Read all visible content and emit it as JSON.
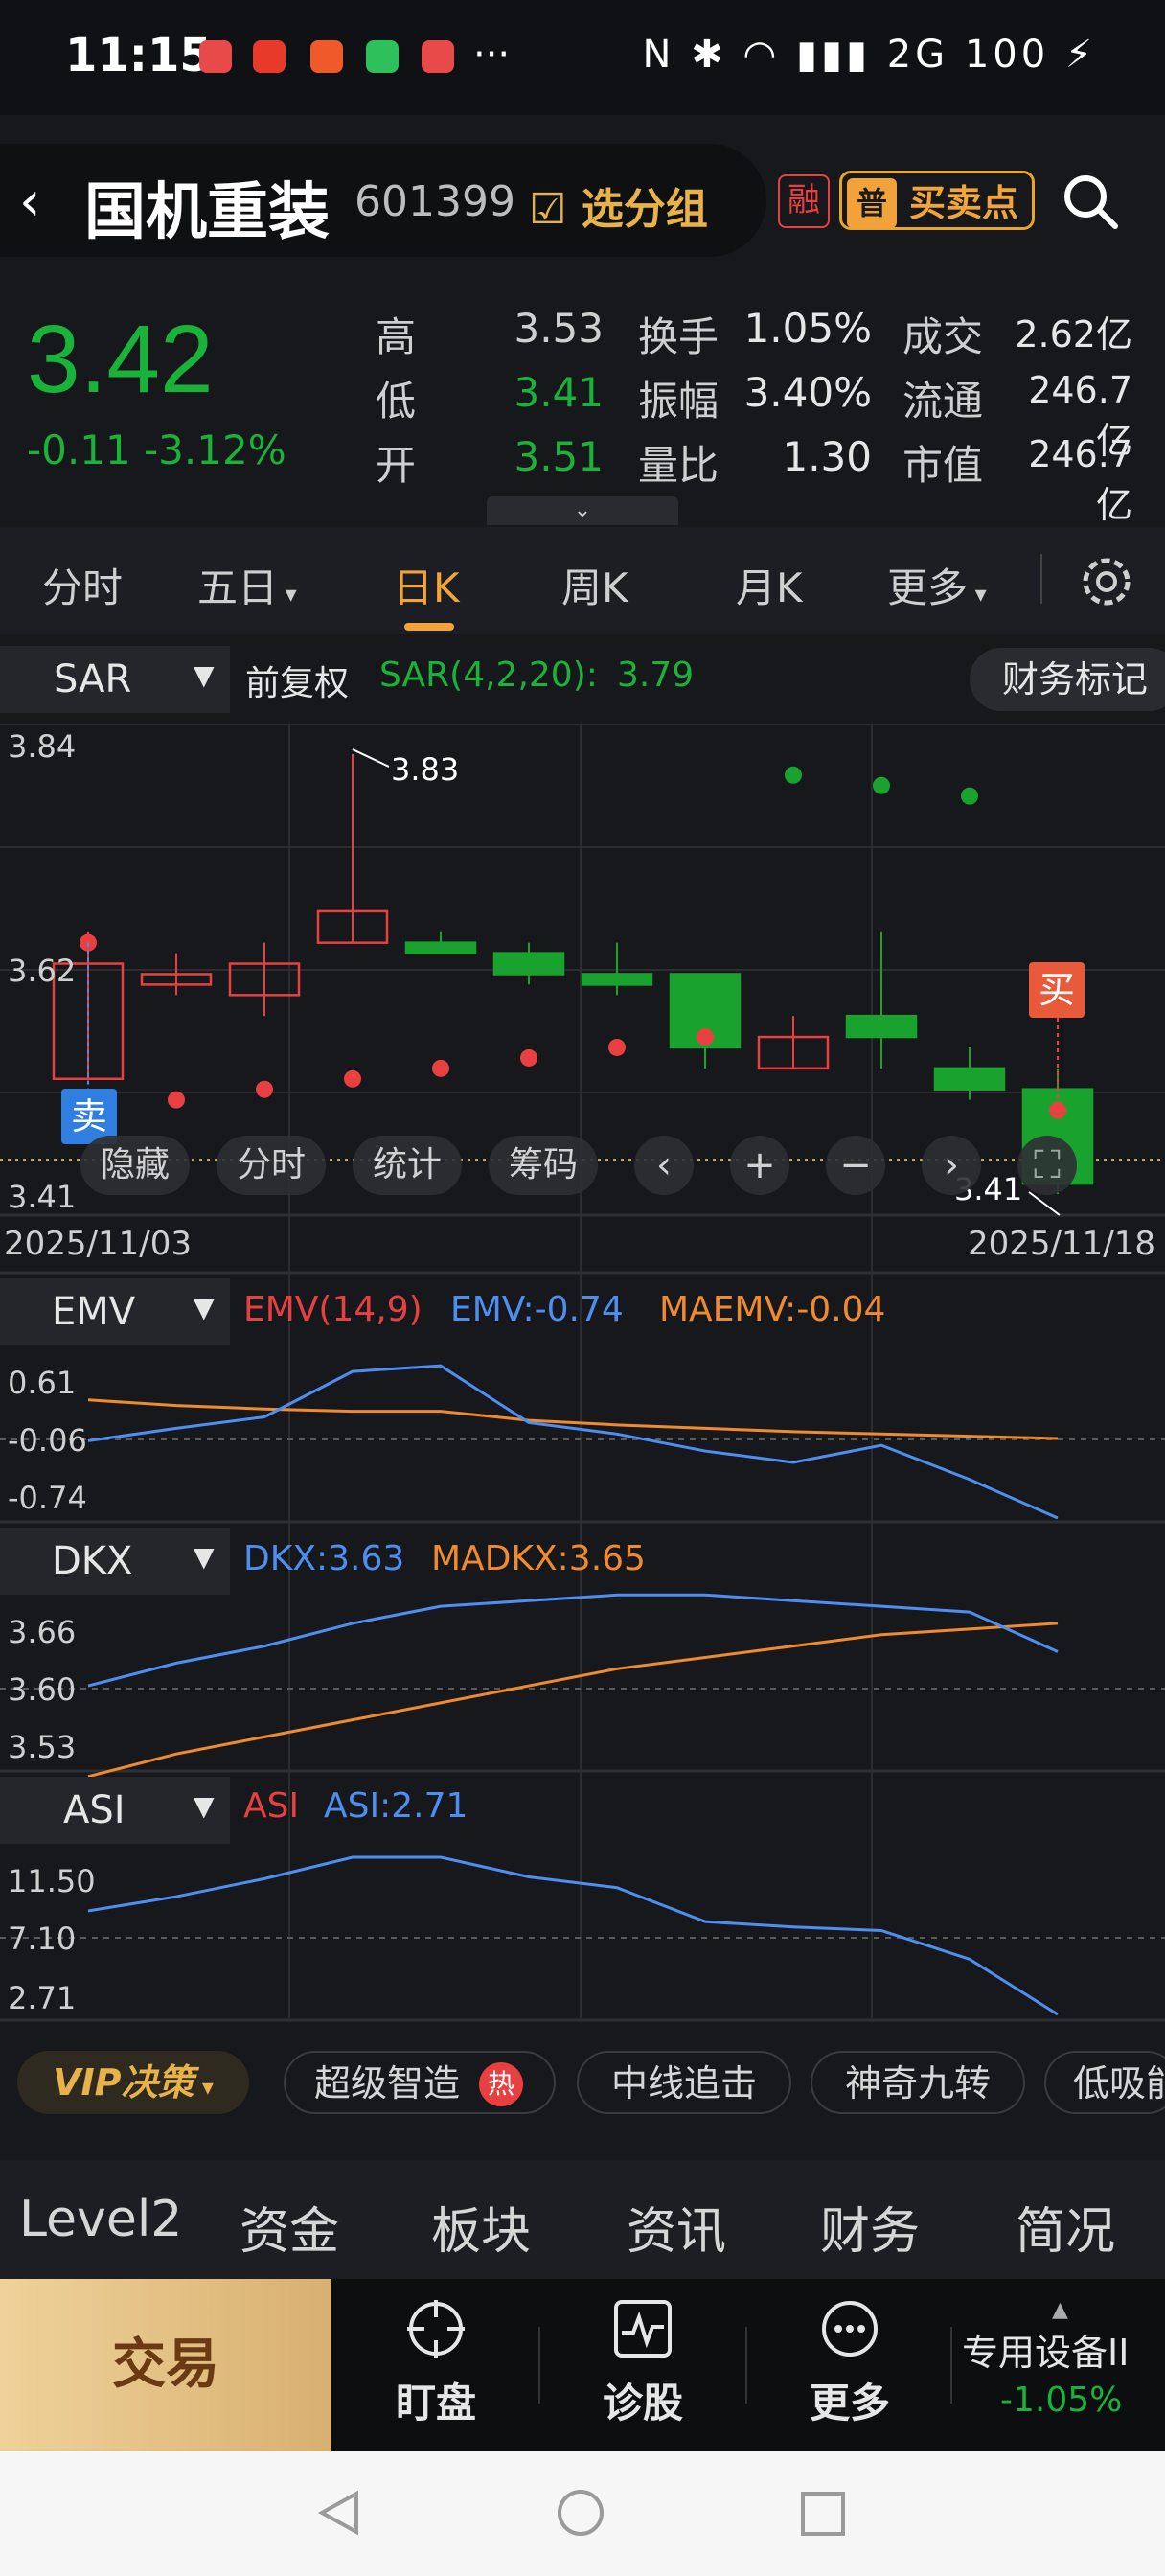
{
  "status_bar": {
    "time": "11:15",
    "right": "N ✱ ◠ ▮▮▮ 2G 100 ⚡",
    "more": "···"
  },
  "header": {
    "stock_name": "国机重装",
    "stock_code": "601399",
    "group_label": "选分组",
    "rong_badge": "融",
    "buysell_label": "买卖点",
    "buysell_icon": "普"
  },
  "quote": {
    "price": "3.42",
    "change": "-0.11 -3.12%",
    "rows": [
      {
        "l1": "高",
        "v1": "3.53",
        "c1": "#cfcfcf",
        "l2": "换手",
        "v2": "1.05%",
        "l3": "成交",
        "v3": "2.62亿"
      },
      {
        "l1": "低",
        "v1": "3.41",
        "c1": "#19b33a",
        "l2": "振幅",
        "v2": "3.40%",
        "l3": "流通",
        "v3": "246.7亿"
      },
      {
        "l1": "开",
        "v1": "3.51",
        "c1": "#19b33a",
        "l2": "量比",
        "v2": "1.30",
        "l3": "市值",
        "v3": "246.7亿"
      }
    ]
  },
  "period_tabs": [
    "分时",
    "五日",
    "日K",
    "周K",
    "月K",
    "更多"
  ],
  "sar_panel": {
    "selector": "SAR",
    "adjust": "前复权",
    "indicator": "SAR(4,2,20):",
    "value": "3.79",
    "finance_btn": "财务标记",
    "y_labels": [
      "3.84",
      "3.62",
      "3.41"
    ],
    "high_label": "3.83",
    "low_label": "3.41",
    "date_start": "2025/11/03",
    "date_end": "2025/11/18",
    "sell_marker": "卖",
    "buy_marker": "买",
    "tools": [
      "隐藏",
      "分时",
      "统计",
      "筹码"
    ]
  },
  "emv_panel": {
    "selector": "EMV",
    "name": "EMV(14,9)",
    "emv": "EMV:-0.74",
    "maemv": "MAEMV:-0.04",
    "y_labels": [
      "0.61",
      "-0.06",
      "-0.74"
    ]
  },
  "dkx_panel": {
    "selector": "DKX",
    "dkx": "DKX:3.63",
    "madkx": "MADKX:3.65",
    "y_labels": [
      "3.66",
      "3.60",
      "3.53"
    ]
  },
  "asi_panel": {
    "selector": "ASI",
    "name": "ASI",
    "asi": "ASI:2.71",
    "y_labels": [
      "11.50",
      "7.10",
      "2.71"
    ]
  },
  "chart_data": {
    "type": "candlestick",
    "dates": [
      "2025/11/03",
      "2025/11/18"
    ],
    "candles": [
      {
        "open": 3.52,
        "close": 3.63,
        "high": 3.66,
        "low": 3.52
      },
      {
        "open": 3.61,
        "close": 3.62,
        "high": 3.64,
        "low": 3.6
      },
      {
        "open": 3.6,
        "close": 3.63,
        "high": 3.65,
        "low": 3.58
      },
      {
        "open": 3.65,
        "close": 3.68,
        "high": 3.83,
        "low": 3.65
      },
      {
        "open": 3.65,
        "close": 3.64,
        "high": 3.66,
        "low": 3.64
      },
      {
        "open": 3.64,
        "close": 3.62,
        "high": 3.65,
        "low": 3.61
      },
      {
        "open": 3.62,
        "close": 3.61,
        "high": 3.65,
        "low": 3.6
      },
      {
        "open": 3.62,
        "close": 3.55,
        "high": 3.62,
        "low": 3.53
      },
      {
        "open": 3.53,
        "close": 3.56,
        "high": 3.58,
        "low": 3.53
      },
      {
        "open": 3.58,
        "close": 3.56,
        "high": 3.66,
        "low": 3.53
      },
      {
        "open": 3.53,
        "close": 3.51,
        "high": 3.55,
        "low": 3.5
      },
      {
        "open": 3.51,
        "close": 3.42,
        "high": 3.53,
        "low": 3.41
      }
    ],
    "sar": [
      3.65,
      3.5,
      3.51,
      3.52,
      3.53,
      3.54,
      3.55,
      3.56,
      3.81,
      3.8,
      3.79,
      3.49
    ],
    "emv": [
      -0.06,
      0.05,
      0.15,
      0.55,
      0.6,
      0.1,
      0.0,
      -0.15,
      -0.25,
      -0.1,
      -0.4,
      -0.74
    ],
    "maemv": [
      0.3,
      0.25,
      0.22,
      0.2,
      0.2,
      0.12,
      0.08,
      0.05,
      0.02,
      0.0,
      -0.02,
      -0.04
    ],
    "dkx": [
      3.6,
      3.62,
      3.635,
      3.655,
      3.67,
      3.675,
      3.68,
      3.68,
      3.675,
      3.67,
      3.665,
      3.63
    ],
    "madkx": [
      3.52,
      3.54,
      3.555,
      3.57,
      3.585,
      3.6,
      3.615,
      3.625,
      3.635,
      3.645,
      3.65,
      3.655
    ],
    "asi": [
      8.5,
      9.3,
      10.3,
      11.5,
      11.5,
      10.4,
      9.8,
      7.9,
      7.6,
      7.4,
      5.8,
      2.71
    ],
    "y_ranges": {
      "sar": [
        3.41,
        3.84
      ],
      "emv": [
        -0.74,
        0.61
      ],
      "dkx": [
        3.53,
        3.66
      ],
      "asi": [
        2.71,
        11.5
      ]
    },
    "colors": {
      "up": "#e84040",
      "down": "#19a32e",
      "emv": "#4d8ef0",
      "maemv": "#f08a2e"
    }
  },
  "strategy_row": {
    "vip": "VIP决策",
    "chips": [
      "超级智造",
      "中线追击",
      "神奇九转",
      "低吸能"
    ],
    "hot": "热"
  },
  "info_tabs": [
    "Level2",
    "资金",
    "板块",
    "资讯",
    "财务",
    "简况"
  ],
  "bottom_bar": {
    "trade": "交易",
    "items": [
      "盯盘",
      "诊股",
      "更多"
    ],
    "device_name": "专用设备II",
    "device_change": "-1.05%"
  }
}
